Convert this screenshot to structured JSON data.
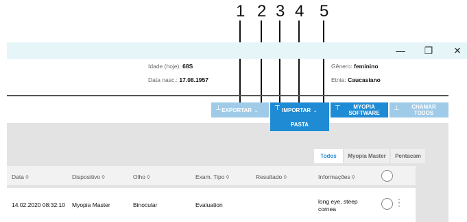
{
  "callouts": [
    "1",
    "2",
    "3",
    "4",
    "5"
  ],
  "window": {
    "minimize": "—",
    "restore": "❐",
    "close": "✕"
  },
  "patient": {
    "age_label": "Idade (hoje):",
    "age_value": "68S",
    "dob_label": "Data nasc.:",
    "dob_value": "17.08.1957",
    "gender_label": "Gênero:",
    "gender_value": "feminino",
    "ethnicity_label": "Etnia:",
    "ethnicity_value": "Caucasiano"
  },
  "toolbar": {
    "exportar": "EXPORTAR",
    "importar": "IMPORTAR",
    "myopia_line1": "MYOPIA",
    "myopia_line2": "SOFTWARE",
    "chamar_line1": "CHAMAR",
    "chamar_line2": "TODOS",
    "pasta": "PASTA"
  },
  "tabs": [
    "Todos",
    "Myopia Master",
    "Pentacam"
  ],
  "table": {
    "columns": [
      "Data ◊",
      "Dispositivo ◊",
      "Olho ◊",
      "Exam. Tipo ◊",
      "Resultado ◊",
      "Informações ◊"
    ],
    "rows": [
      {
        "data": "14.02.2020 08:32:10",
        "dispositivo": "Myopia Master",
        "olho": "Binocular",
        "exam_tipo": "Evaluation",
        "resultado": "",
        "info_line1": "long eye, steep",
        "info_line2": "cornea"
      }
    ]
  },
  "colors": {
    "accent": "#1f8bd4",
    "accent_light": "#9fcbe8",
    "titlebar": "#e6f6f8"
  }
}
